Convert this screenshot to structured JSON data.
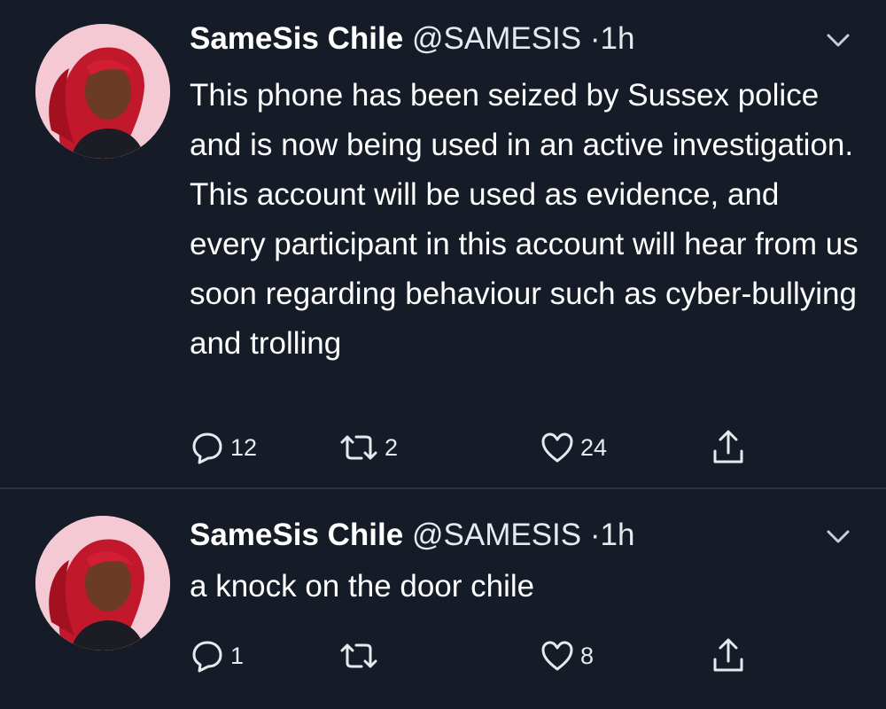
{
  "tweets": [
    {
      "name": "SameSis Chile",
      "handle": "@SAMESIS",
      "separator": "·",
      "time": "1h",
      "text": "This phone has been seized by Sussex police and is now being used in an active investigation. This account will be used as evidence, and every participant in this account will hear from us soon regarding behaviour such as cyber-bullying and trolling",
      "replies": "12",
      "retweets": "2",
      "likes": "24"
    },
    {
      "name": "SameSis Chile",
      "handle": "@SAMESIS",
      "separator": "·",
      "time": "1h",
      "text": "a knock on the door chile",
      "replies": "1",
      "retweets": "",
      "likes": "8"
    }
  ],
  "colors": {
    "background": "#151c27",
    "text": "#ffffff",
    "secondary_text": "#e6e9ee",
    "divider": "#2a3340",
    "avatar_background": "#f4c9d4"
  },
  "icons": [
    "chevron-down-icon",
    "reply-icon",
    "retweet-icon",
    "like-icon",
    "share-icon"
  ]
}
